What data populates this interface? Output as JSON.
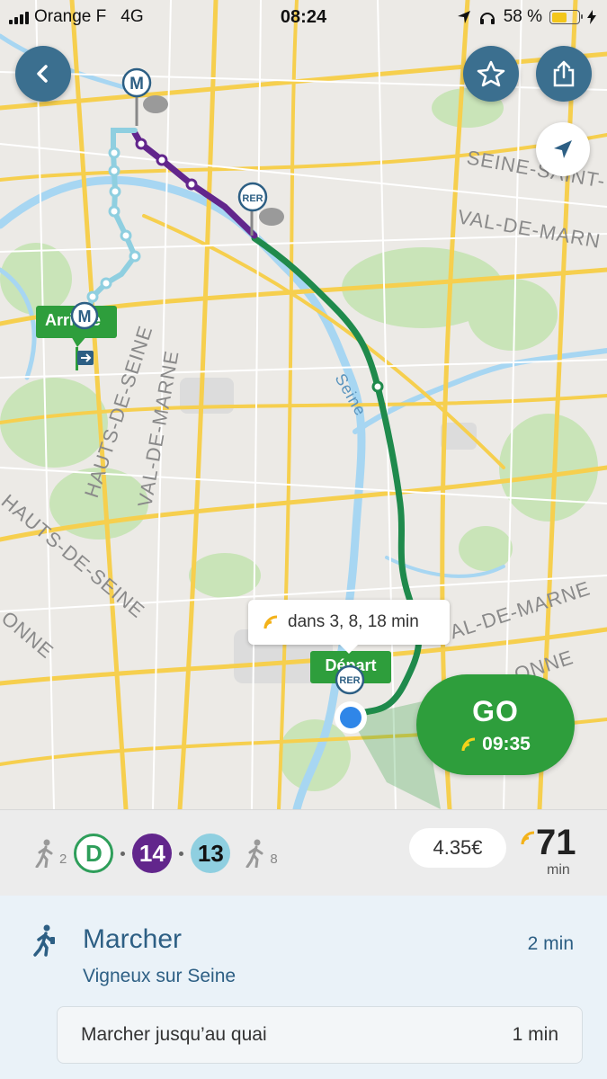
{
  "status_bar": {
    "carrier": "Orange F",
    "network": "4G",
    "time": "08:24",
    "battery_percent": "58 %"
  },
  "map": {
    "labels": {
      "seine_saint": "SEINE-SAINT-",
      "val_de_marne_ne": "VAL-DE-MARN",
      "seine": "Seine",
      "hauts_de_seine_1": "HAUTS-DE-SEINE",
      "val_de_marne_w": "VAL-DE-MARNE",
      "hauts_de_seine_2": "HAUTS-DE-SEINE",
      "essonne": "ONNE",
      "val_de_marne_se": "VAL-DE-MARNE",
      "essonne_se": "ONNE"
    },
    "arrival_label": "Arrivée",
    "departure_label": "Départ",
    "metro_symbol": "M",
    "rer_symbol": "RER",
    "realtime_bubble": "dans 3, 8, 18 min",
    "go": {
      "label": "GO",
      "time": "09:35"
    },
    "colors": {
      "green_route": "#1f8a4c",
      "purple_route": "#62268c",
      "blue_route": "#8fcfe0",
      "water": "#a7d6f2",
      "park": "#c7e6b3"
    }
  },
  "summary": {
    "walk_start_min": "2",
    "lines": [
      "D",
      "14",
      "13"
    ],
    "walk_end_min": "8",
    "price": "4.35€",
    "duration": "71",
    "duration_unit": "min"
  },
  "step": {
    "title": "Marcher",
    "duration": "2 min",
    "location": "Vigneux sur Seine",
    "instruction": "Marcher jusqu’au quai",
    "instruction_duration": "1 min"
  }
}
